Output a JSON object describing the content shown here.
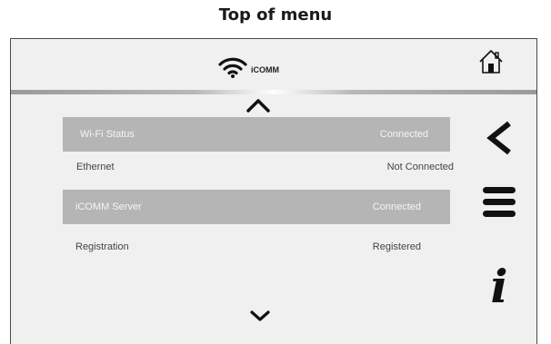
{
  "caption": "Top of menu",
  "header": {
    "network_label": "iCOMM",
    "icons": {
      "wifi": "wifi-icon",
      "home": "home-icon"
    }
  },
  "rows": [
    {
      "label": "Wi-Fi Status",
      "value": "Connected",
      "shaded": true
    },
    {
      "label": "Ethernet",
      "value": "Not Connected",
      "shaded": false
    },
    {
      "label": "iCOMM Server",
      "value": "Connected",
      "shaded": true
    },
    {
      "label": "Registration",
      "value": "Registered",
      "shaded": false
    }
  ],
  "side_buttons": {
    "back": "chevron-left-icon",
    "menu": "hamburger-menu-icon",
    "info": "i"
  },
  "scroll": {
    "up": "chevron-up-icon",
    "down": "chevron-down-icon"
  },
  "colors": {
    "panel_bg": "#f0f0f0",
    "row_shaded_bg": "#b5b5b5",
    "row_shaded_text": "#f5f5f5",
    "row_text": "#444444",
    "icon": "#111111"
  }
}
